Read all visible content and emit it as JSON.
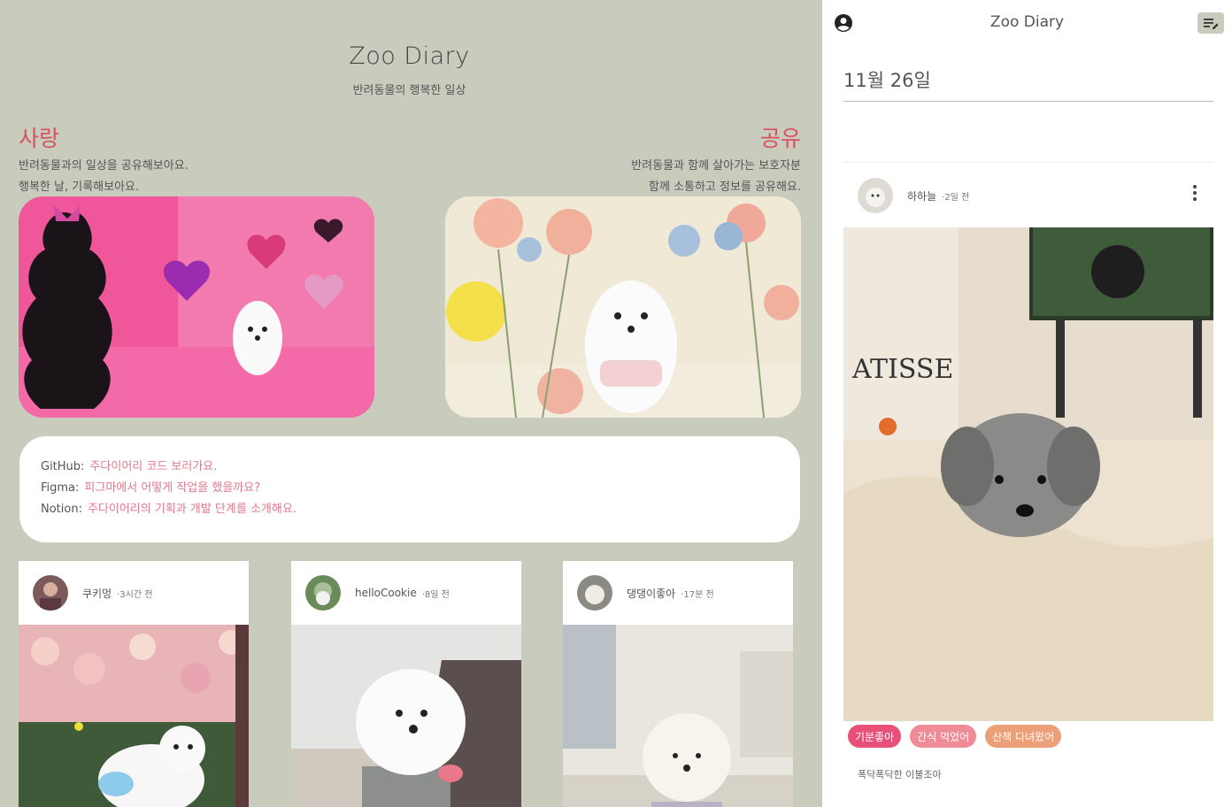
{
  "left": {
    "site_title": "Zoo Diary",
    "site_subtitle": "반려동물의 행복한 일상",
    "love": {
      "heading": "사랑",
      "lines": [
        "반려동물과의 일상을 공유해보아요.",
        "행복한 날, 기록해보아요."
      ]
    },
    "share": {
      "heading": "공유",
      "lines": [
        "반려동물과 함께 살아가는 보호자분",
        "함께 소통하고 정보를 공유해요."
      ]
    },
    "links": [
      {
        "label": "GitHub:",
        "text": "주다이어리 코드 보러가요."
      },
      {
        "label": "Figma:",
        "text": "피그마에서 어떻게 작업을 했을까요?"
      },
      {
        "label": "Notion:",
        "text": "주다이어리의 기획과 개발 단계를 소개해요."
      }
    ],
    "posts": [
      {
        "user": "쿠키멍",
        "time": "·3시간 전"
      },
      {
        "user": "helloCookie",
        "time": "·8일 전"
      },
      {
        "user": "댕댕이좋아",
        "time": "·17분 전"
      }
    ]
  },
  "right": {
    "title": "Zoo Diary",
    "date": "11월 26일",
    "post": {
      "user": "하하늘",
      "time": "·2일 전",
      "tags": [
        {
          "label": "기분좋아",
          "color": "#e8507a"
        },
        {
          "label": "간식 먹었어",
          "color": "#ef8b96"
        },
        {
          "label": "산책 다녀왔어",
          "color": "#eba07a"
        }
      ],
      "caption": "폭닥폭닥한 이불조아"
    }
  },
  "colors": {
    "background": "#c9cbbd",
    "accent": "#d9505f",
    "link": "#e07a8d"
  },
  "icons": {
    "profile": "account-circle-icon",
    "edit": "edit-note-icon",
    "more": "more-vertical-icon"
  }
}
